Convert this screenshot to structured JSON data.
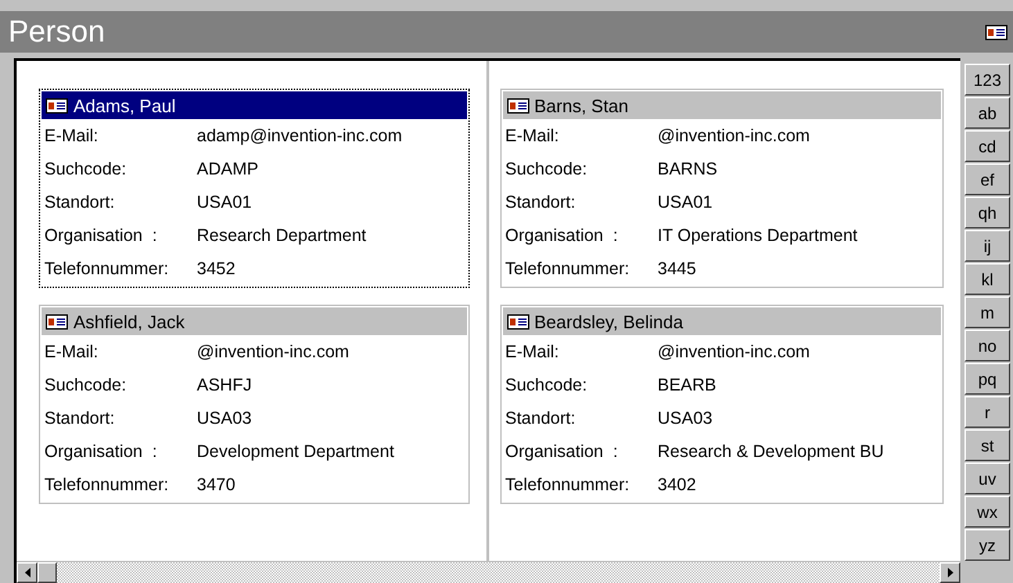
{
  "window": {
    "title": "Person"
  },
  "cards": [
    {
      "name": "Adams, Paul",
      "selected": true,
      "fields": [
        {
          "label": "E-Mail:",
          "value": "adamp@invention-inc.com"
        },
        {
          "label": "Suchcode:",
          "value": "ADAMP"
        },
        {
          "label": "Standort:",
          "value": "USA01"
        },
        {
          "label": "Organisation  :",
          "value": "Research Department"
        },
        {
          "label": "Telefonnummer:",
          "value": "3452"
        }
      ]
    },
    {
      "name": "Barns, Stan",
      "selected": false,
      "fields": [
        {
          "label": "E-Mail:",
          "value": "@invention-inc.com"
        },
        {
          "label": "Suchcode:",
          "value": "BARNS"
        },
        {
          "label": "Standort:",
          "value": "USA01"
        },
        {
          "label": "Organisation  :",
          "value": "IT Operations Department"
        },
        {
          "label": "Telefonnummer:",
          "value": "3445"
        }
      ]
    },
    {
      "name": "Ashfield, Jack",
      "selected": false,
      "fields": [
        {
          "label": "E-Mail:",
          "value": "@invention-inc.com"
        },
        {
          "label": "Suchcode:",
          "value": "ASHFJ"
        },
        {
          "label": "Standort:",
          "value": "USA03"
        },
        {
          "label": "Organisation  :",
          "value": "Development Department"
        },
        {
          "label": "Telefonnummer:",
          "value": "3470"
        }
      ]
    },
    {
      "name": "Beardsley, Belinda",
      "selected": false,
      "fields": [
        {
          "label": "E-Mail:",
          "value": "@invention-inc.com"
        },
        {
          "label": "Suchcode:",
          "value": "BEARB"
        },
        {
          "label": "Standort:",
          "value": "USA03"
        },
        {
          "label": "Organisation  :",
          "value": "Research & Development BU"
        },
        {
          "label": "Telefonnummer:",
          "value": "3402"
        }
      ]
    }
  ],
  "index_buttons": [
    "123",
    "ab",
    "cd",
    "ef",
    "qh",
    "ij",
    "kl",
    "m",
    "no",
    "pq",
    "r",
    "st",
    "uv",
    "wx",
    "yz"
  ]
}
